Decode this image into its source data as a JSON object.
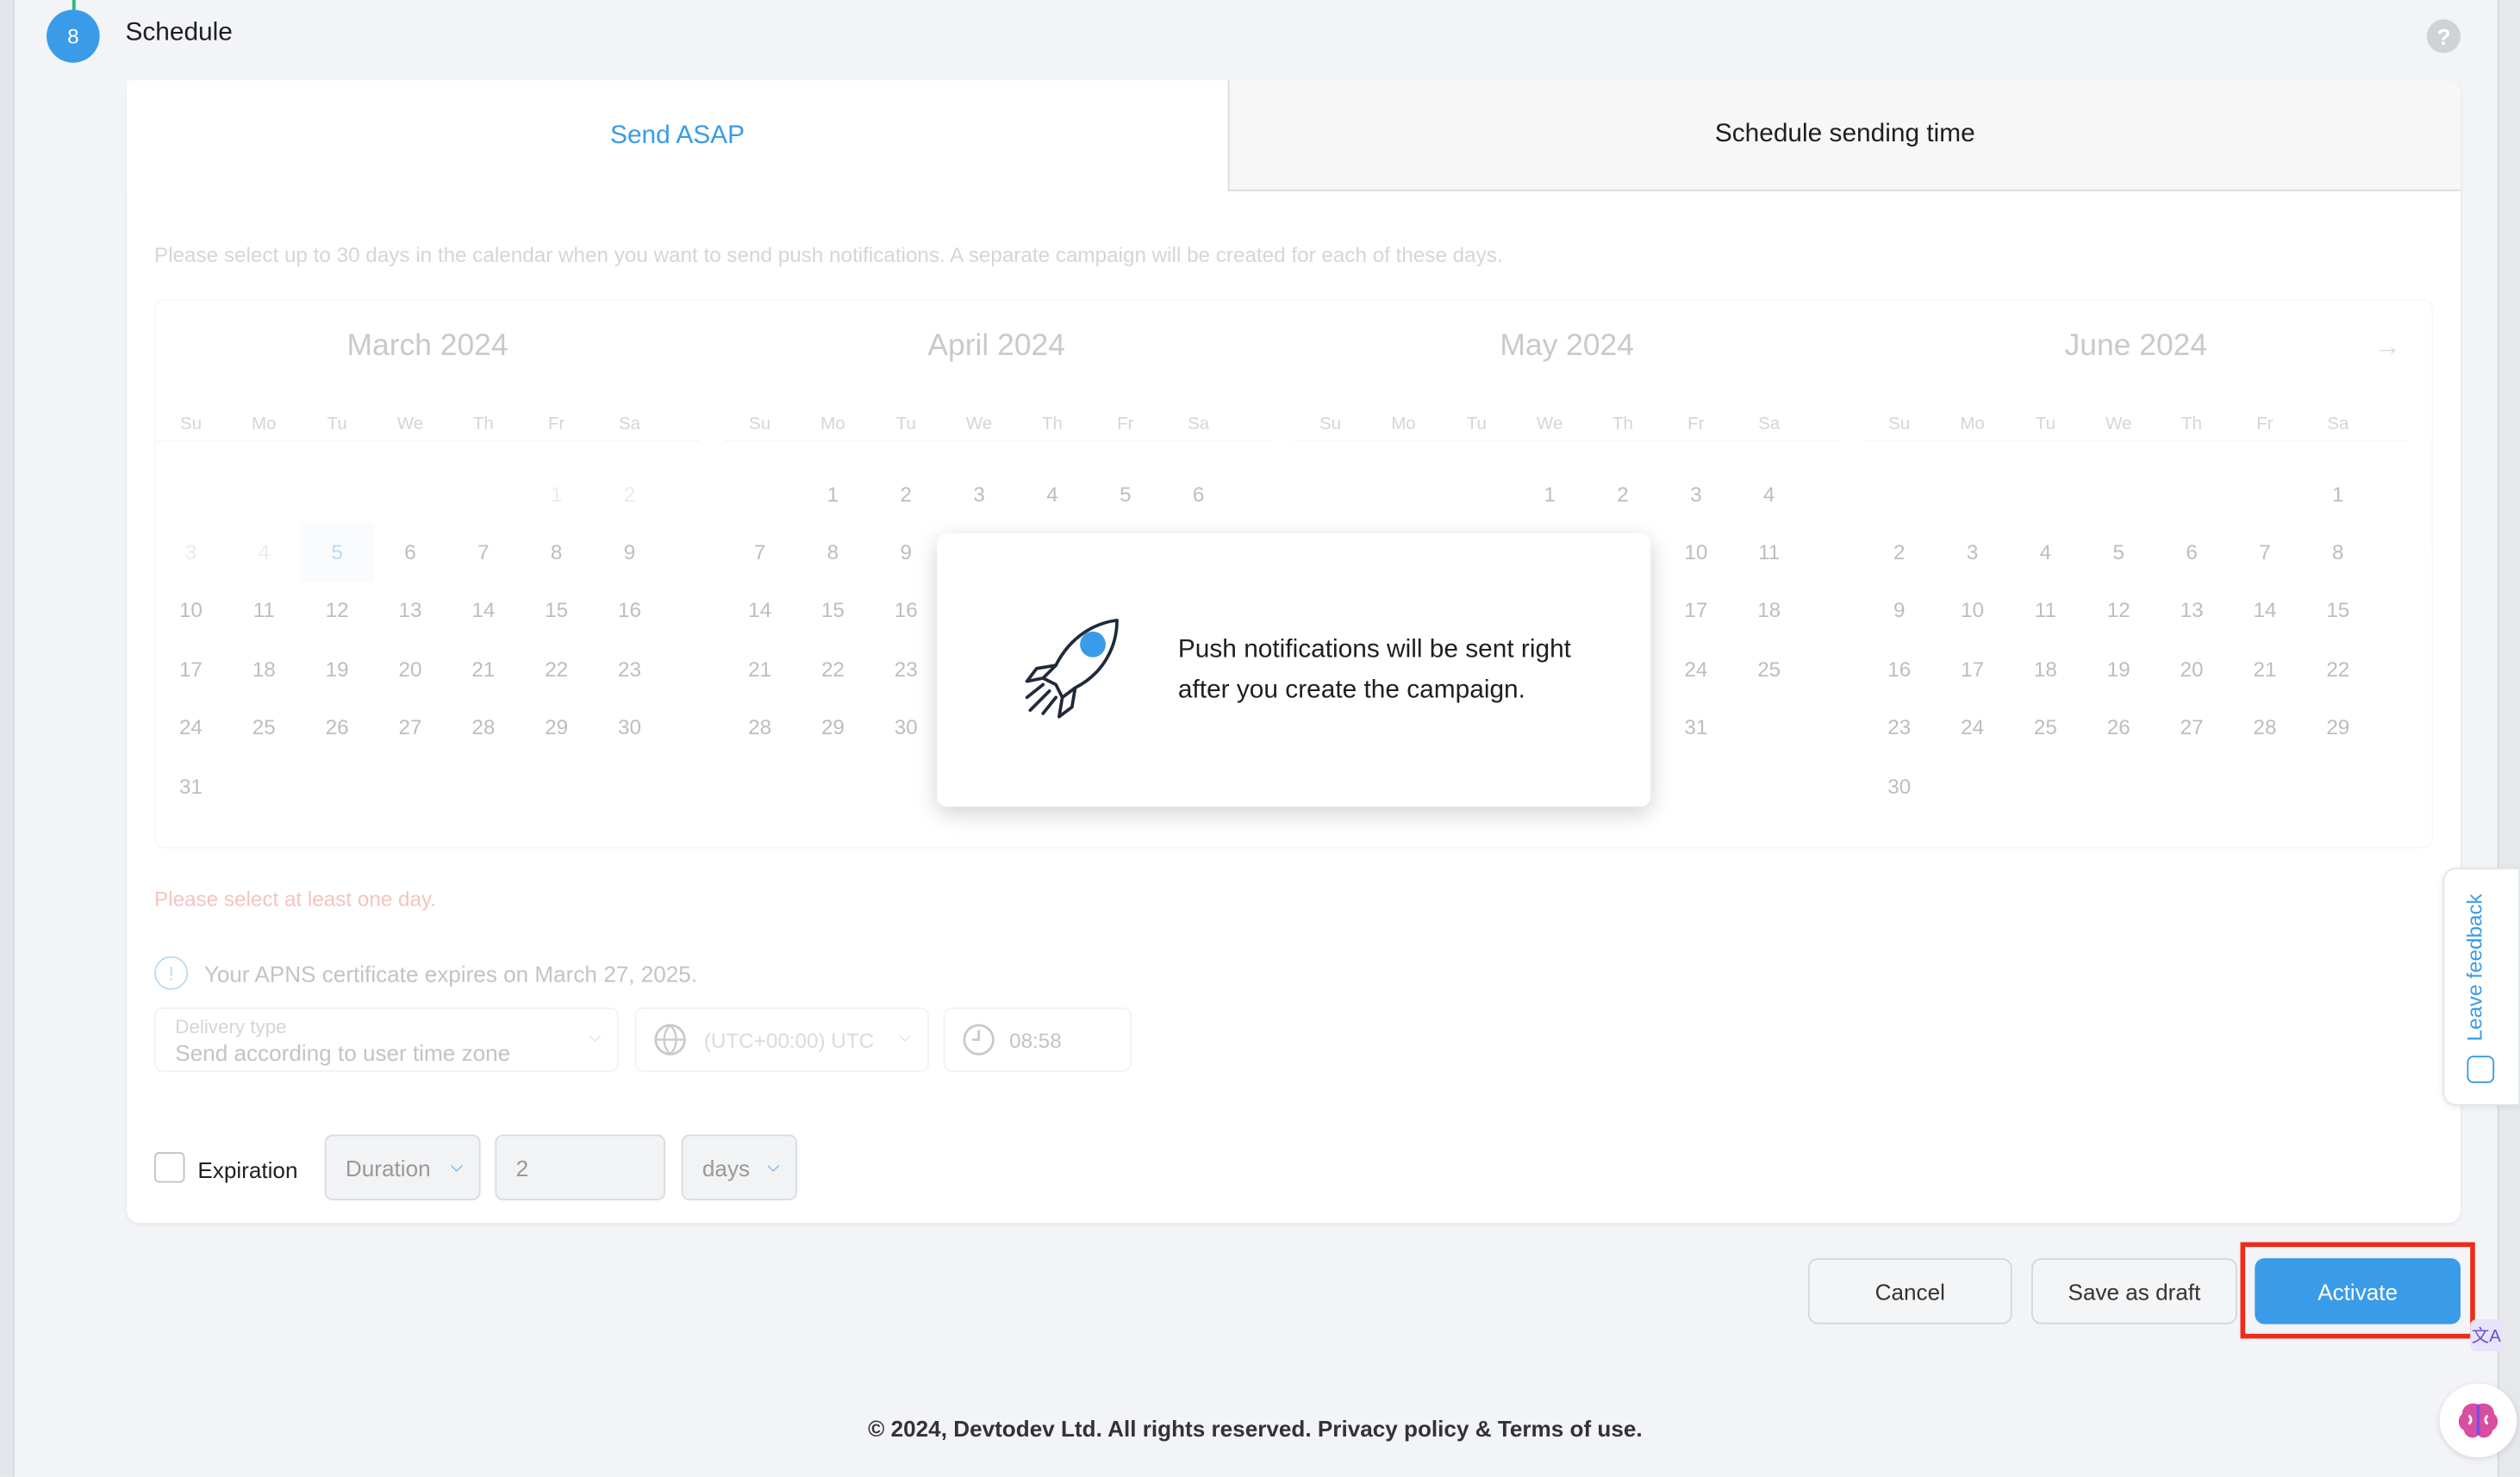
{
  "step": {
    "number": "8",
    "title": "Schedule",
    "help": "?"
  },
  "tabs": {
    "send_asap": "Send ASAP",
    "schedule_time": "Schedule sending time"
  },
  "hint": "Please select up to 30 days in the calendar when you want to send push notifications. A separate campaign will be created for each of these days.",
  "calendar": {
    "next_arrow": "→",
    "weekdays": [
      "Su",
      "Mo",
      "Tu",
      "We",
      "Th",
      "Fr",
      "Sa"
    ],
    "months": [
      {
        "title": "March 2024",
        "lead": 5,
        "days": 31,
        "disabled_until": 4,
        "today": 5
      },
      {
        "title": "April 2024",
        "lead": 1,
        "days": 30,
        "disabled_until": 0,
        "today": 0
      },
      {
        "title": "May 2024",
        "lead": 3,
        "days": 31,
        "disabled_until": 0,
        "today": 0
      },
      {
        "title": "June 2024",
        "lead": 6,
        "days": 30,
        "disabled_until": 0,
        "today": 0
      }
    ]
  },
  "popup": {
    "text": "Push notifications will be sent right after you create the campaign."
  },
  "error": "Please select at least one day.",
  "apns": {
    "icon": "!",
    "text": "Your APNS certificate expires on March 27, 2025."
  },
  "delivery": {
    "label": "Delivery type",
    "value": "Send according to user time zone",
    "timezone": "(UTC+00:00) UTC",
    "time": "08:58"
  },
  "expiration": {
    "label": "Expiration",
    "mode": "Duration",
    "amount": "2",
    "unit": "days"
  },
  "buttons": {
    "cancel": "Cancel",
    "draft": "Save as draft",
    "activate": "Activate"
  },
  "feedback": "Leave feedback",
  "translate_icon": "文A",
  "footer": "© 2024, Devtodev Ltd. All rights reserved. Privacy policy & Terms of use."
}
